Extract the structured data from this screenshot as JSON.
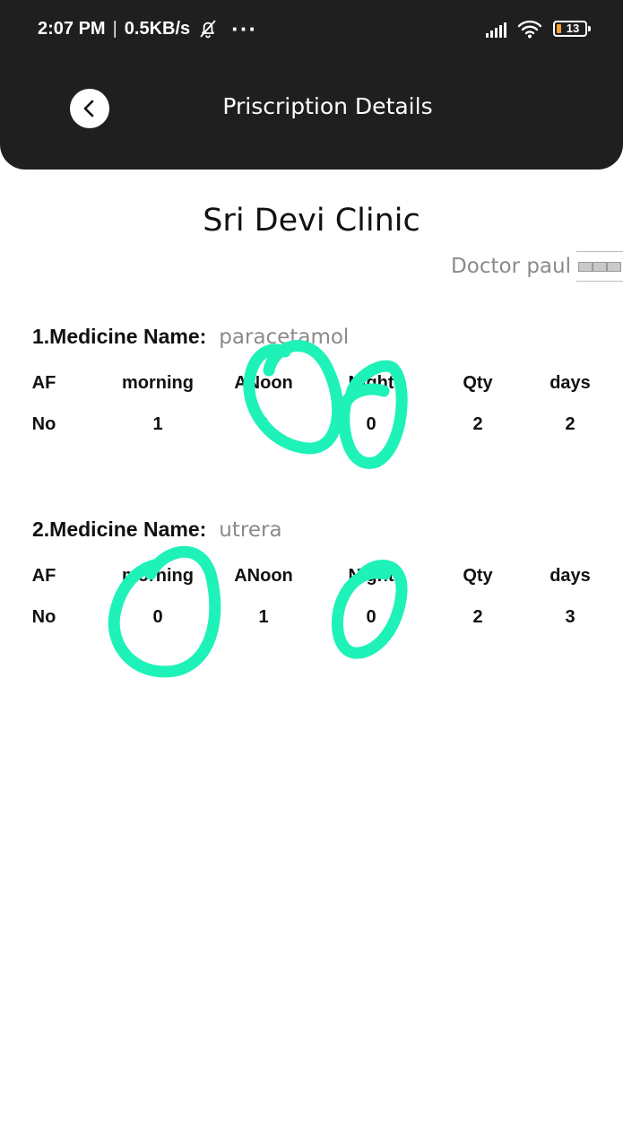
{
  "status_bar": {
    "time": "2:07 PM",
    "separator": "|",
    "speed": "0.5KB/s",
    "more": "···",
    "battery_level": "13",
    "icons": [
      "bell-muted-icon",
      "signal-icon",
      "wifi-icon",
      "battery-icon"
    ]
  },
  "header": {
    "title": "Priscription Details",
    "back_icon": "chevron-left-icon"
  },
  "clinic_name": "Sri Devi Clinic",
  "doctor_name": "Doctor paul",
  "column_headers": [
    "AF",
    "morning",
    "ANoon",
    "Night",
    "Qty",
    "days"
  ],
  "medicines": [
    {
      "label": "1.Medicine Name:",
      "name": "paracetamol",
      "values": [
        "No",
        "1",
        "0",
        "0",
        "2",
        "2"
      ]
    },
    {
      "label": "2.Medicine Name:",
      "name": "utrera",
      "values": [
        "No",
        "0",
        "1",
        "0",
        "2",
        "3"
      ]
    }
  ],
  "annotation_color": "#1ef2b8",
  "colors": {
    "header_bg": "#1f1f1f",
    "muted_text": "#8a8a8a"
  }
}
